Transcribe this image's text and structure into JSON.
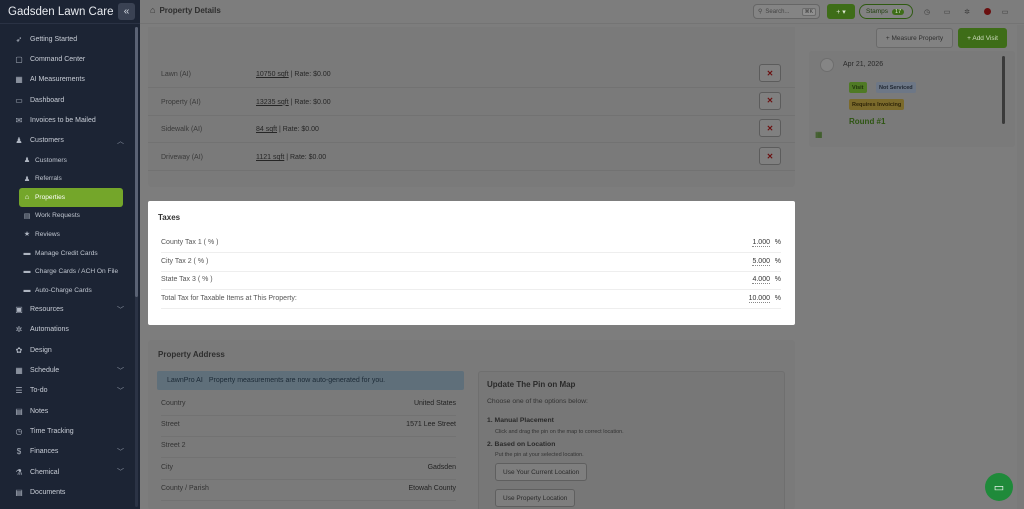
{
  "app": {
    "name": "Gadsden Lawn Care"
  },
  "sidebar": {
    "items": [
      {
        "label": "Getting Started",
        "icon": "rocket-icon"
      },
      {
        "label": "Command Center",
        "icon": "chat-icon"
      },
      {
        "label": "AI Measurements",
        "icon": "grid-icon"
      },
      {
        "label": "Dashboard",
        "icon": "monitor-icon"
      },
      {
        "label": "Invoices to be Mailed",
        "icon": "mail-icon"
      },
      {
        "label": "Customers",
        "icon": "users-icon"
      }
    ],
    "sub_items": [
      {
        "label": "Customers",
        "icon": "user-icon"
      },
      {
        "label": "Referrals",
        "icon": "user-plus-icon"
      },
      {
        "label": "Properties",
        "icon": "home-icon"
      },
      {
        "label": "Work Requests",
        "icon": "doc-icon"
      },
      {
        "label": "Reviews",
        "icon": "star-icon"
      },
      {
        "label": "Manage Credit Cards",
        "icon": "card-icon"
      },
      {
        "label": "Charge Cards / ACH On File",
        "icon": "card-icon"
      },
      {
        "label": "Auto-Charge Cards",
        "icon": "card-icon"
      }
    ],
    "items_bottom": [
      {
        "label": "Resources",
        "icon": "box-icon"
      },
      {
        "label": "Automations",
        "icon": "gear-icon"
      },
      {
        "label": "Design",
        "icon": "leaf-icon"
      },
      {
        "label": "Schedule",
        "icon": "calendar-icon"
      },
      {
        "label": "To-do",
        "icon": "checklist-icon"
      },
      {
        "label": "Notes",
        "icon": "note-icon"
      },
      {
        "label": "Time Tracking",
        "icon": "clock-icon"
      },
      {
        "label": "Finances",
        "icon": "dollar-icon"
      },
      {
        "label": "Chemical",
        "icon": "flask-icon"
      },
      {
        "label": "Documents",
        "icon": "file-icon"
      }
    ]
  },
  "header": {
    "title": "Property Details",
    "search_placeholder": "Search...",
    "search_shortcut": "⌘K",
    "stamps_label": "Stamps",
    "stamps_count": "17"
  },
  "rates": [
    {
      "label": "Lawn (AI)",
      "sqft": "10750 sqft",
      "rate": " | Rate: $0.00"
    },
    {
      "label": "Property (AI)",
      "sqft": "13235 sqft",
      "rate": " | Rate: $0.00"
    },
    {
      "label": "Sidewalk (AI)",
      "sqft": "84 sqft",
      "rate": " | Rate: $0.00"
    },
    {
      "label": "Driveway (AI)",
      "sqft": "1121 sqft",
      "rate": " | Rate: $0.00"
    }
  ],
  "taxes": {
    "title": "Taxes",
    "rows": [
      {
        "label": "County Tax 1 ( % )",
        "value": "1.000",
        "unit": "%"
      },
      {
        "label": "City Tax 2 ( % )",
        "value": "5.000",
        "unit": "%"
      },
      {
        "label": "State Tax 3 ( % )",
        "value": "4.000",
        "unit": "%"
      },
      {
        "label": "Total Tax for Taxable Items at This Property:",
        "value": "10.000",
        "unit": "%"
      }
    ]
  },
  "address": {
    "title": "Property Address",
    "banner_brand": "LawnPro AI",
    "banner_text": "Property measurements are now auto-generated for you.",
    "rows": [
      {
        "label": "Country",
        "value": "United States"
      },
      {
        "label": "Street",
        "value": "1571 Lee Street"
      },
      {
        "label": "Street 2",
        "value": ""
      },
      {
        "label": "City",
        "value": "Gadsden"
      },
      {
        "label": "County / Parish",
        "value": "Etowah County"
      }
    ]
  },
  "pin": {
    "title": "Update The Pin on Map",
    "subtitle": "Choose one of the options below:",
    "opt1_title": "1. Manual Placement",
    "opt1_desc": "Click and drag the pin on the map to correct location.",
    "opt2_title": "2. Based on Location",
    "opt2_desc": "Put the pin at your selected location.",
    "btn_current": "Use Your Current Location",
    "btn_property": "Use Property Location"
  },
  "actions": {
    "measure": "+ Measure Property",
    "add_visit": "+ Add Visit"
  },
  "visit": {
    "date": "Apr 21, 2026",
    "tag_visit": "Visit",
    "tag_status": "Not Serviced",
    "tag_invoice": "Requires Invoicing",
    "round": "Round #1"
  }
}
